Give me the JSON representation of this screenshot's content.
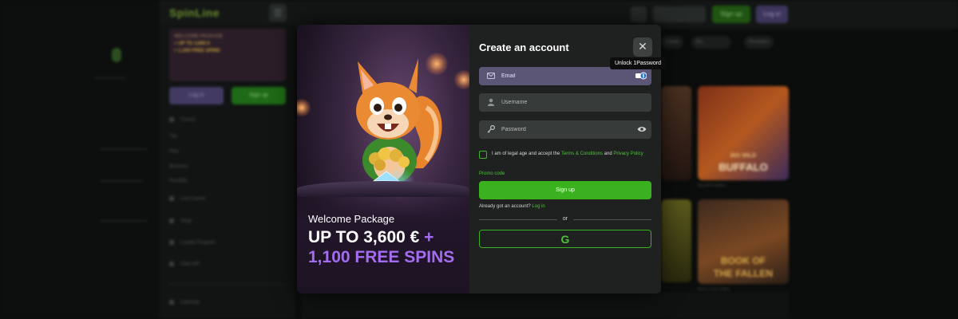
{
  "background": {
    "logo": "SpinLine",
    "menu_icon": "☰",
    "header": {
      "sign_up": "Sign up",
      "log_in": "Log in"
    },
    "sidebar": {
      "promo_line1": "WELCOME PACKAGE",
      "promo_line2": "+ UP TO 3,600 €",
      "promo_line3": "+ 1,100 FREE SPINS",
      "log_in": "Log in",
      "sign_up": "Sign up",
      "items": [
        "Casino",
        "Top",
        "New",
        "Bonuses",
        "Roulette",
        "Live Casino",
        "Shop",
        "Loyalty Program",
        "Club VIP",
        "Calendar"
      ]
    },
    "categories": [
      "Cards",
      "Bo...",
      "Providers"
    ],
    "tiles": [
      "Big Wild Buffalo",
      "Book of the Fallen"
    ],
    "tile_text": [
      "BIG WILD",
      "BUFFALO",
      "BOOK OF",
      "THE FALLEN"
    ]
  },
  "modal": {
    "promo": {
      "pre_title": "Welcome Package",
      "line1_amount": "UP TO 3,600 €",
      "line1_plus": "+",
      "line2": "1,100 FREE SPINS",
      "colors": {
        "accent": "#a46cf0"
      }
    },
    "form": {
      "title": "Create an account",
      "close_glyph": "✕",
      "tooltip": "Unlock 1Password",
      "email_placeholder": "Email",
      "username_placeholder": "Username",
      "password_placeholder": "Password",
      "agree_prefix": "I am of legal age and accept the",
      "terms_link": "Terms & Conditions",
      "agree_and": "and",
      "privacy_link": "Privacy Policy",
      "promo_code": "Promo code",
      "signup_button": "Sign up",
      "already_text": "Already got an account?",
      "login_link": "Log in",
      "or_text": "or",
      "google_glyph": "G",
      "colors": {
        "primary": "#3ab21f",
        "link": "#4ec23a",
        "active_field": "#5b5676"
      }
    }
  }
}
